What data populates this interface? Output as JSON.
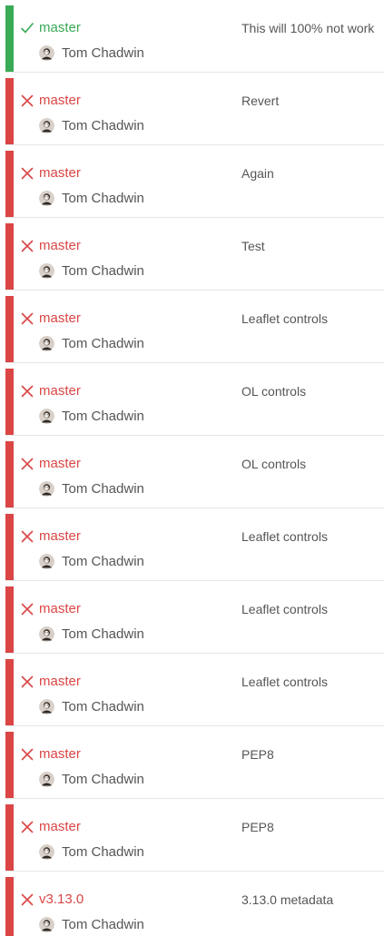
{
  "colors": {
    "passed": "#39aa56",
    "failed": "#db4545",
    "text": "#555555",
    "divider": "#e6e6e6"
  },
  "builds": [
    {
      "state": "passed",
      "state_icon": "check-icon",
      "branch": "master",
      "author": "Tom Chadwin",
      "message": "This will 100% not work"
    },
    {
      "state": "failed",
      "state_icon": "cross-icon",
      "branch": "master",
      "author": "Tom Chadwin",
      "message": "Revert"
    },
    {
      "state": "failed",
      "state_icon": "cross-icon",
      "branch": "master",
      "author": "Tom Chadwin",
      "message": "Again"
    },
    {
      "state": "failed",
      "state_icon": "cross-icon",
      "branch": "master",
      "author": "Tom Chadwin",
      "message": "Test"
    },
    {
      "state": "failed",
      "state_icon": "cross-icon",
      "branch": "master",
      "author": "Tom Chadwin",
      "message": "Leaflet controls"
    },
    {
      "state": "failed",
      "state_icon": "cross-icon",
      "branch": "master",
      "author": "Tom Chadwin",
      "message": "OL controls"
    },
    {
      "state": "failed",
      "state_icon": "cross-icon",
      "branch": "master",
      "author": "Tom Chadwin",
      "message": "OL controls"
    },
    {
      "state": "failed",
      "state_icon": "cross-icon",
      "branch": "master",
      "author": "Tom Chadwin",
      "message": "Leaflet controls"
    },
    {
      "state": "failed",
      "state_icon": "cross-icon",
      "branch": "master",
      "author": "Tom Chadwin",
      "message": "Leaflet controls"
    },
    {
      "state": "failed",
      "state_icon": "cross-icon",
      "branch": "master",
      "author": "Tom Chadwin",
      "message": "Leaflet controls"
    },
    {
      "state": "failed",
      "state_icon": "cross-icon",
      "branch": "master",
      "author": "Tom Chadwin",
      "message": "PEP8"
    },
    {
      "state": "failed",
      "state_icon": "cross-icon",
      "branch": "master",
      "author": "Tom Chadwin",
      "message": "PEP8"
    },
    {
      "state": "failed",
      "state_icon": "cross-icon",
      "branch": "v3.13.0",
      "author": "Tom Chadwin",
      "message": "3.13.0 metadata"
    }
  ]
}
